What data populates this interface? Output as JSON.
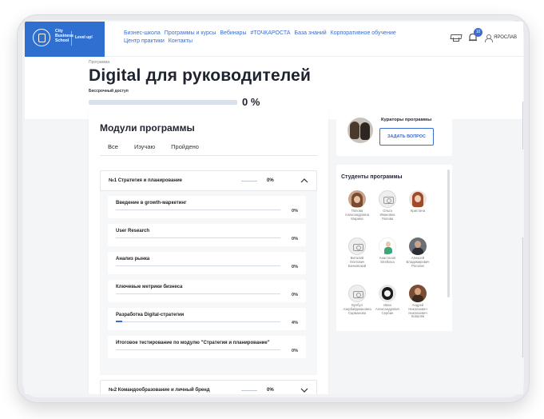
{
  "header": {
    "logo_text": "City\nBusiness\nSchool",
    "level_up": "Level up!",
    "nav": [
      "Бизнес-школа",
      "Программы и курсы",
      "Вебинары",
      "#ТОЧКАРОСТА",
      "База знаний",
      "Корпоративное обучение",
      "Центр практики",
      "Контакты"
    ],
    "notifications_count": "10",
    "user_name": "ЯРОСЛАВ"
  },
  "hero": {
    "breadcrumb": "Программа",
    "title": "Digital для руководителей",
    "access": "Бессрочный доступ",
    "progress_percent": "0 %",
    "progress_value": 0
  },
  "modules": {
    "title": "Модули программы",
    "tabs": [
      "Все",
      "Изучаю",
      "Пройдено"
    ],
    "active_tab": 0,
    "module1": {
      "label": "№1 Стратегия и планирование",
      "percent": "0%"
    },
    "module2": {
      "label": "№2 Командообразование и личный бренд",
      "percent": "0%"
    },
    "lessons": [
      {
        "name": "Введение в growth-маркетинг",
        "percent": "0%",
        "value": 0
      },
      {
        "name": "User Research",
        "percent": "0%",
        "value": 0
      },
      {
        "name": "Анализ рынка",
        "percent": "0%",
        "value": 0
      },
      {
        "name": "Ключевые метрики бизнеса",
        "percent": "0%",
        "value": 0
      },
      {
        "name": "Разработка Digital-стратегии",
        "percent": "4%",
        "value": 4
      },
      {
        "name": "Итоговое тестирование по модулю \"Стратегия и планирование\"",
        "percent": "0%",
        "value": 0
      }
    ]
  },
  "curators": {
    "title": "Кураторы программы",
    "ask_button": "ЗАДАТЬ ВОПРОС"
  },
  "students": {
    "title": "Студенты программы",
    "list": [
      {
        "name": "Попова\nАлександровна\nМарина",
        "avatar": "photo-a"
      },
      {
        "name": "Ольга\nИвановна\nПопова",
        "avatar": "cam"
      },
      {
        "name": "Кристина",
        "avatar": "photo-b"
      },
      {
        "name": "Виталий\nОлегович\nБачковский",
        "avatar": "cam"
      },
      {
        "name": "Анастасия\nStrelkova",
        "avatar": "photo-c"
      },
      {
        "name": "Алексей\nВладимирович\nРоголин",
        "avatar": "photo-d"
      },
      {
        "name": "Булбул\nАзербайджановна\nСарманова",
        "avatar": "cam"
      },
      {
        "name": "Иван\nАлександрович\nСербин",
        "avatar": "photo-e"
      },
      {
        "name": "Андрей\nНиколаевич\nНиколаевич\nКовалёв",
        "avatar": "photo-f"
      }
    ]
  },
  "colors": {
    "accent": "#3b6ccf",
    "logo_bg": "#2f6fcf"
  }
}
